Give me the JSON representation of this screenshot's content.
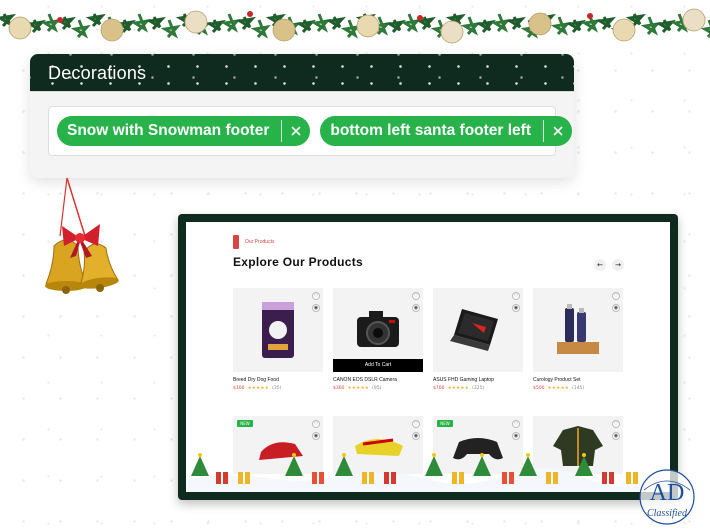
{
  "decorations_panel": {
    "title": "Decorations",
    "chips": [
      {
        "label": "Snow with Snowman footer"
      },
      {
        "label": "bottom left santa footer left"
      }
    ]
  },
  "store_preview": {
    "section_tag": "Our Products",
    "section_title": "Explore Our Products",
    "add_to_cart_label": "Add To Cart",
    "products": [
      {
        "name": "Breed Dry Dog Food",
        "price": "$100",
        "stars": "★★★★★",
        "reviews": "(35)",
        "icon": "dog-food-bag-icon"
      },
      {
        "name": "CANON EOS DSLR Camera",
        "price": "$360",
        "stars": "★★★★★",
        "reviews": "(95)",
        "icon": "camera-icon"
      },
      {
        "name": "ASUS FHD Gaming Laptop",
        "price": "$700",
        "stars": "★★★★★",
        "reviews": "(325)",
        "icon": "laptop-icon"
      },
      {
        "name": "Curology Product Set",
        "price": "$500",
        "stars": "★★★★★",
        "reviews": "(145)",
        "icon": "skincare-set-icon"
      }
    ],
    "second_row": [
      {
        "badge": "NEW",
        "icon": "kids-car-icon"
      },
      {
        "badge": "",
        "icon": "soccer-cleats-icon"
      },
      {
        "badge": "NEW",
        "icon": "gamepad-icon"
      },
      {
        "badge": "",
        "icon": "jacket-icon"
      }
    ]
  },
  "watermark": {
    "letters": "AD",
    "caption": "Classified"
  },
  "colors": {
    "dark_green": "#0f2a1e",
    "chip_green": "#27b24a",
    "accent_red": "#db4444",
    "star": "#ffad33"
  }
}
